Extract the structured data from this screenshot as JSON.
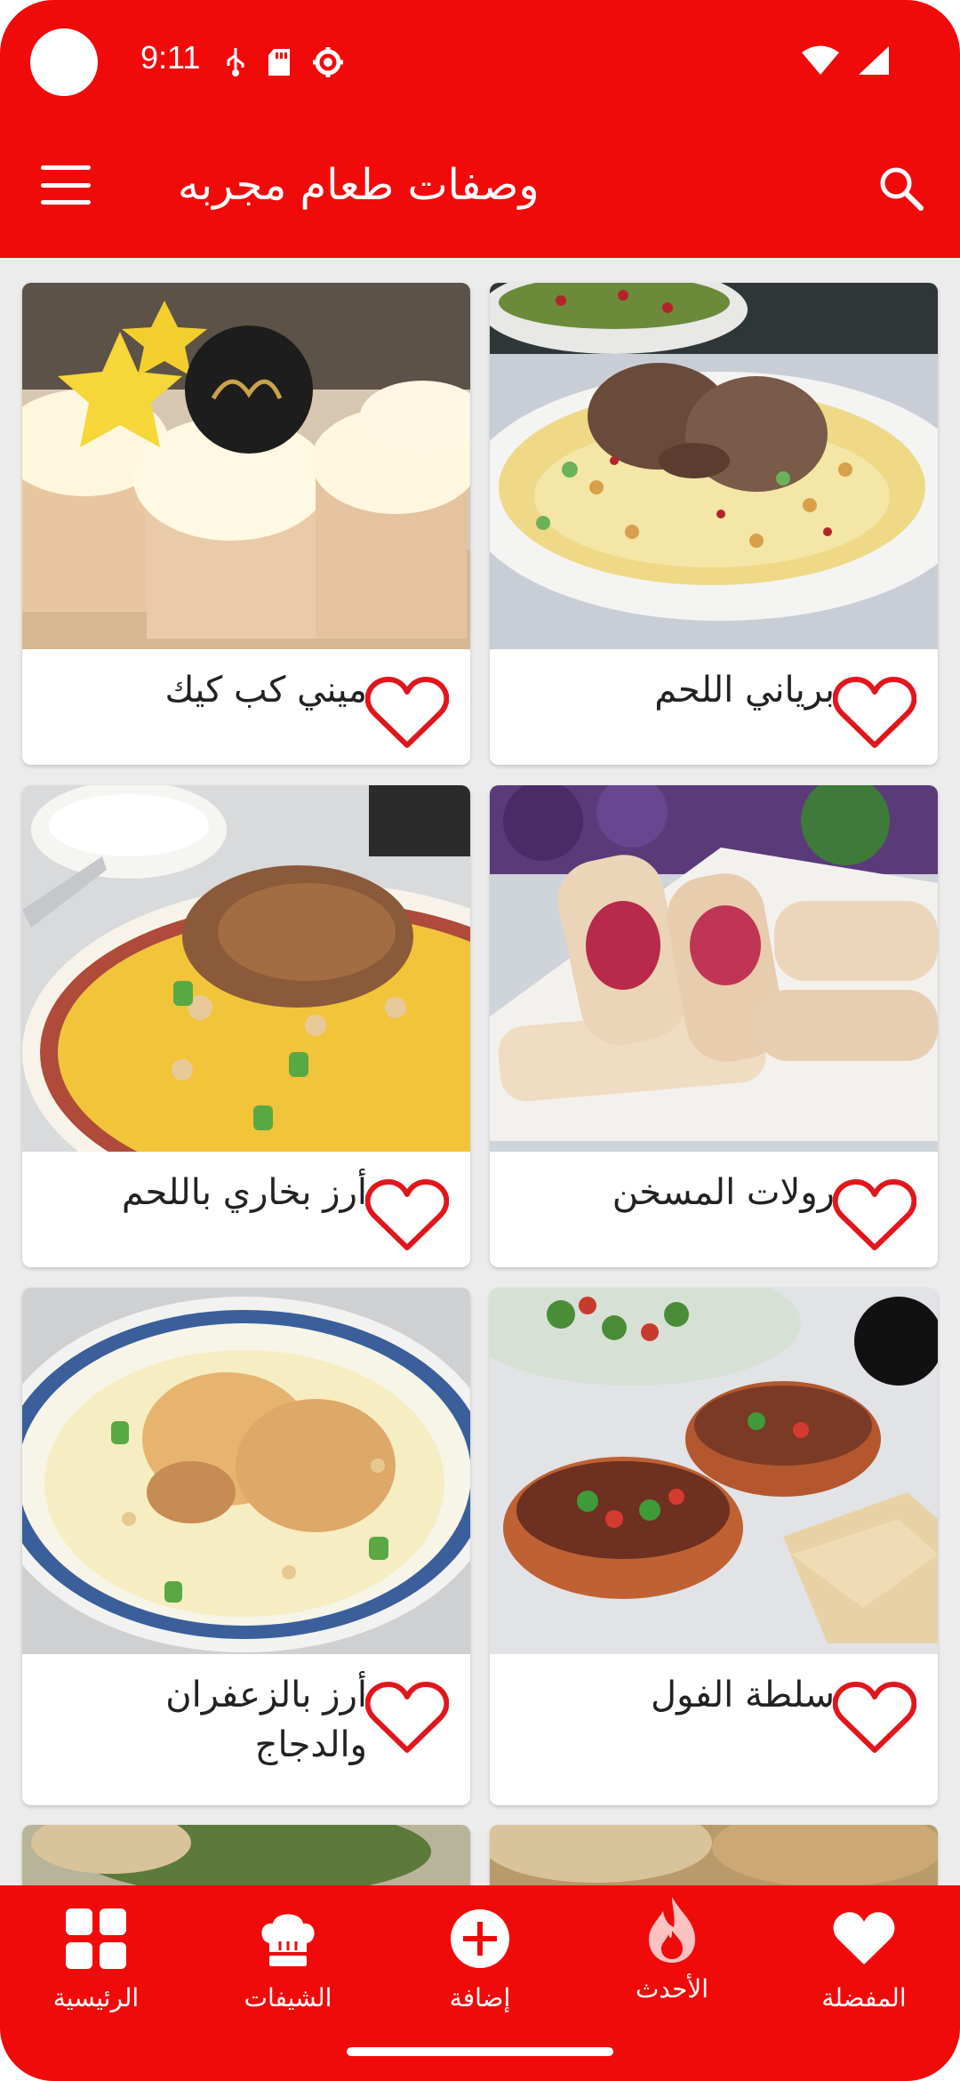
{
  "status_bar": {
    "time": "9:11"
  },
  "app_bar": {
    "title": "وصفات طعام مجربه"
  },
  "recipes": [
    {
      "title": "بورياني اللحم",
      "title_exact": "برياني اللحم"
    },
    {
      "title": "ميني كب كيك"
    },
    {
      "title": "رولات المسخن"
    },
    {
      "title": "أرز بخاري باللحم"
    },
    {
      "title": "سلطة الفول"
    },
    {
      "title": "أرز بالزعفران والدجاج"
    }
  ],
  "bottom_nav": {
    "favorites": "المفضلة",
    "latest": "الأحدث",
    "add": "إضافة",
    "chefs": "الشيفات",
    "home": "الرئيسية"
  },
  "colors": {
    "primary": "#f10a0a",
    "background": "#ececec",
    "card": "#ffffff"
  }
}
